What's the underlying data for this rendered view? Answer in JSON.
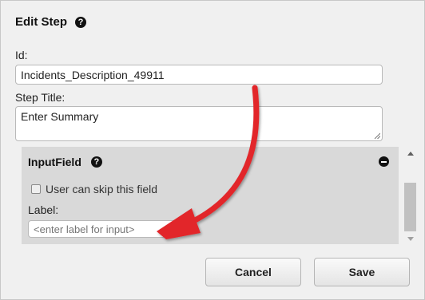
{
  "dialog": {
    "title": "Edit Step",
    "help_icon": "?"
  },
  "form": {
    "id_label": "Id:",
    "id_value": "Incidents_Description_49911",
    "step_title_label": "Step Title:",
    "step_title_value": "Enter Summary"
  },
  "input_field_panel": {
    "title": "InputField",
    "help_icon": "?",
    "skip_checkbox_label": "User can skip this field",
    "skip_checked": false,
    "label_label": "Label:",
    "label_placeholder": "<enter label for input>"
  },
  "buttons": {
    "cancel": "Cancel",
    "save": "Save"
  },
  "annotation": {
    "arrow_color": "#e2262b"
  }
}
